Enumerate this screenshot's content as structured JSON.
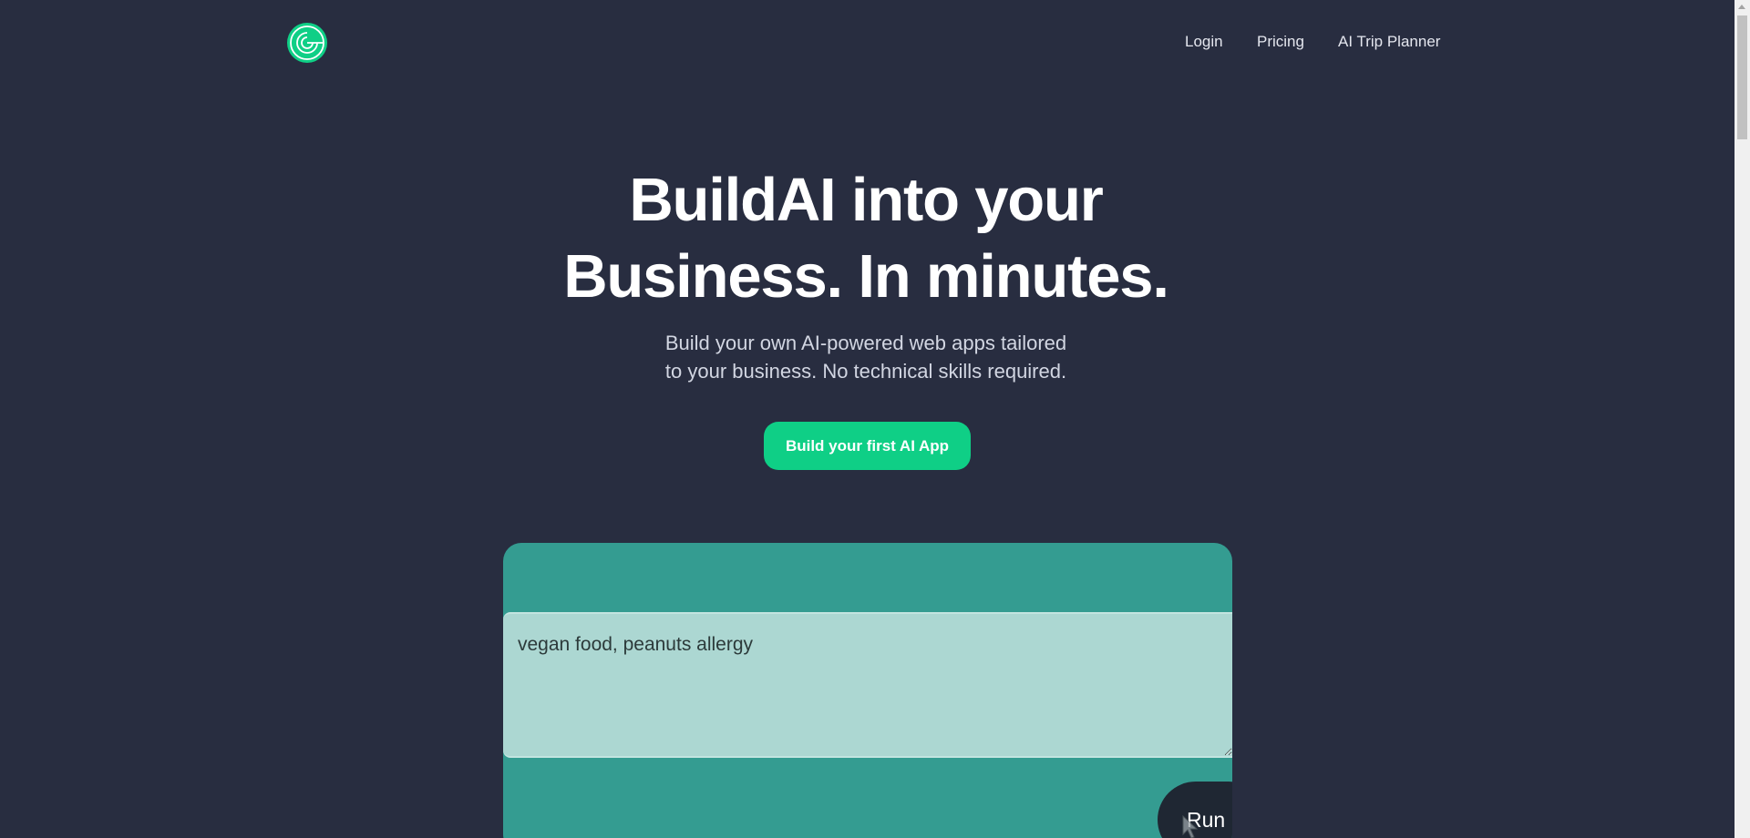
{
  "brand": {
    "logo_icon": "concentric-rings-logo-icon",
    "accent_color": "#0fcf86"
  },
  "nav": {
    "items": [
      {
        "label": "Login"
      },
      {
        "label": "Pricing"
      },
      {
        "label": "AI Trip Planner"
      }
    ]
  },
  "hero": {
    "title_line1": "BuildAI into your",
    "title_line2": "Business. In minutes.",
    "subtitle_line1": "Build your own AI-powered web apps tailored",
    "subtitle_line2": "to your business. No technical skills required.",
    "cta_label": "Build your first AI App"
  },
  "demo": {
    "input_value": "vegan food, peanuts allergy",
    "run_label": "Run",
    "card_color": "#349c91",
    "input_color": "#acd7d2"
  },
  "colors": {
    "background": "#282d40"
  }
}
